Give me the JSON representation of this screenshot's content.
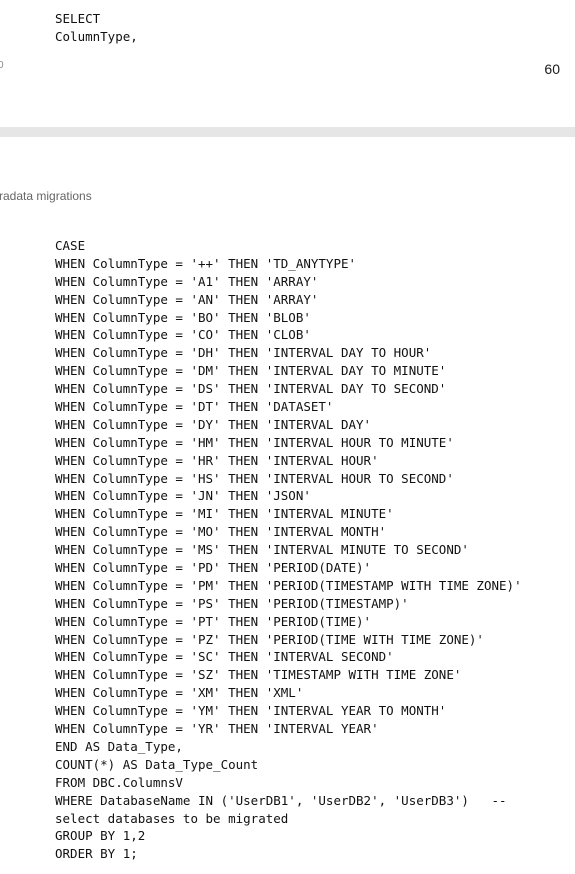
{
  "page_top": {
    "code_lines": [
      "SELECT",
      "ColumnType,"
    ],
    "left_margin_number": "0",
    "page_number": "60"
  },
  "page_bottom": {
    "running_header": "radata migrations",
    "code_lines": [
      "CASE",
      "WHEN ColumnType = '++' THEN 'TD_ANYTYPE'",
      "WHEN ColumnType = 'A1' THEN 'ARRAY'",
      "WHEN ColumnType = 'AN' THEN 'ARRAY'",
      "WHEN ColumnType = 'BO' THEN 'BLOB'",
      "WHEN ColumnType = 'CO' THEN 'CLOB'",
      "WHEN ColumnType = 'DH' THEN 'INTERVAL DAY TO HOUR'",
      "WHEN ColumnType = 'DM' THEN 'INTERVAL DAY TO MINUTE'",
      "WHEN ColumnType = 'DS' THEN 'INTERVAL DAY TO SECOND'",
      "WHEN ColumnType = 'DT' THEN 'DATASET'",
      "WHEN ColumnType = 'DY' THEN 'INTERVAL DAY'",
      "WHEN ColumnType = 'HM' THEN 'INTERVAL HOUR TO MINUTE'",
      "WHEN ColumnType = 'HR' THEN 'INTERVAL HOUR'",
      "WHEN ColumnType = 'HS' THEN 'INTERVAL HOUR TO SECOND'",
      "WHEN ColumnType = 'JN' THEN 'JSON'",
      "WHEN ColumnType = 'MI' THEN 'INTERVAL MINUTE'",
      "WHEN ColumnType = 'MO' THEN 'INTERVAL MONTH'",
      "WHEN ColumnType = 'MS' THEN 'INTERVAL MINUTE TO SECOND'",
      "WHEN ColumnType = 'PD' THEN 'PERIOD(DATE)'",
      "WHEN ColumnType = 'PM' THEN 'PERIOD(TIMESTAMP WITH TIME ZONE)'",
      "WHEN ColumnType = 'PS' THEN 'PERIOD(TIMESTAMP)'",
      "WHEN ColumnType = 'PT' THEN 'PERIOD(TIME)'",
      "WHEN ColumnType = 'PZ' THEN 'PERIOD(TIME WITH TIME ZONE)'",
      "WHEN ColumnType = 'SC' THEN 'INTERVAL SECOND'",
      "WHEN ColumnType = 'SZ' THEN 'TIMESTAMP WITH TIME ZONE'",
      "WHEN ColumnType = 'XM' THEN 'XML'",
      "WHEN ColumnType = 'YM' THEN 'INTERVAL YEAR TO MONTH'",
      "WHEN ColumnType = 'YR' THEN 'INTERVAL YEAR'",
      "END AS Data_Type,",
      "COUNT(*) AS Data_Type_Count",
      "FROM DBC.ColumnsV",
      "WHERE DatabaseName IN ('UserDB1', 'UserDB2', 'UserDB3')   --",
      "select databases to be migrated",
      "GROUP BY 1,2",
      "ORDER BY 1;"
    ]
  }
}
